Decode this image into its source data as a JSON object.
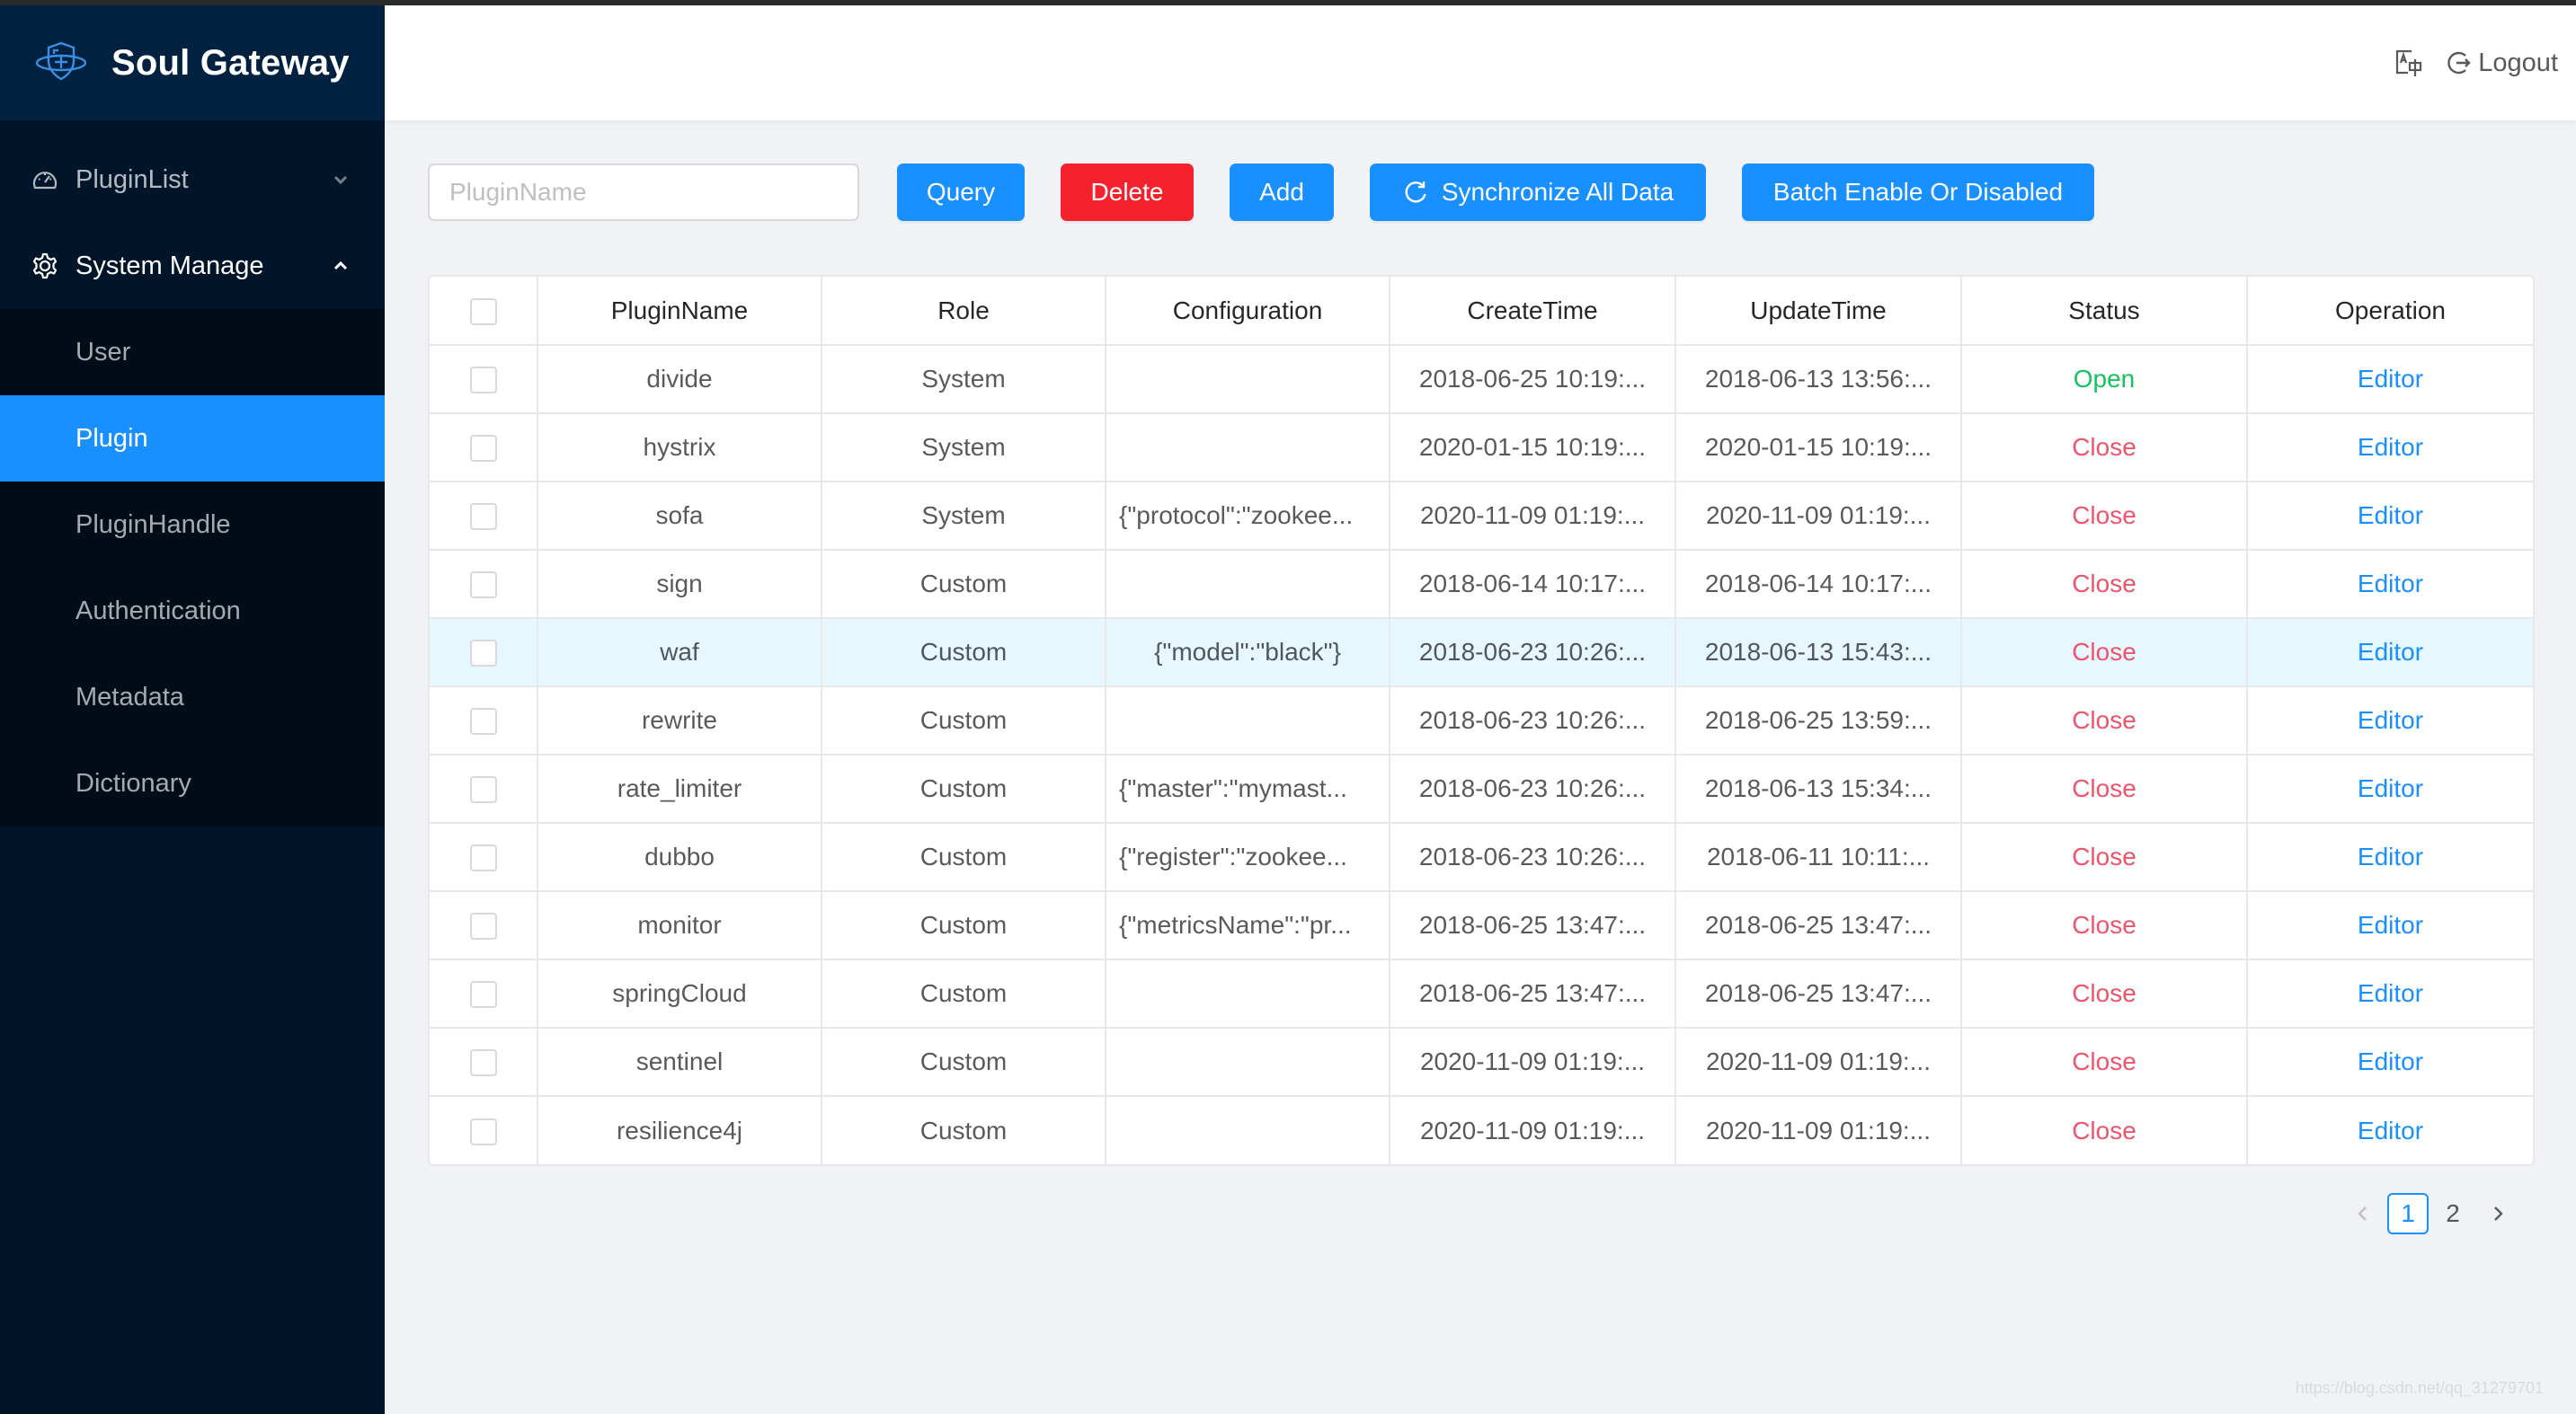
{
  "app": {
    "title": "Soul Gateway",
    "logo_icon": "shield-plus-icon"
  },
  "sidebar": {
    "menus": [
      {
        "label": "PluginList",
        "icon": "dashboard-icon",
        "expanded": false
      },
      {
        "label": "System Manage",
        "icon": "gear-icon",
        "expanded": true
      }
    ],
    "submenu": [
      {
        "label": "User",
        "active": false
      },
      {
        "label": "Plugin",
        "active": true
      },
      {
        "label": "PluginHandle",
        "active": false
      },
      {
        "label": "Authentication",
        "active": false
      },
      {
        "label": "Metadata",
        "active": false
      },
      {
        "label": "Dictionary",
        "active": false
      }
    ]
  },
  "header": {
    "language_icon": "translate-icon",
    "logout_label": "Logout"
  },
  "toolbar": {
    "search_placeholder": "PluginName",
    "search_value": "",
    "query_label": "Query",
    "delete_label": "Delete",
    "add_label": "Add",
    "sync_label": "Synchronize All Data",
    "batch_label": "Batch Enable Or Disabled"
  },
  "table": {
    "columns": [
      "PluginName",
      "Role",
      "Configuration",
      "CreateTime",
      "UpdateTime",
      "Status",
      "Operation"
    ],
    "rows": [
      {
        "name": "divide",
        "role": "System",
        "config": "",
        "create": "2018-06-25 10:19:...",
        "update": "2018-06-13 13:56:...",
        "status": "Open",
        "op": "Editor"
      },
      {
        "name": "hystrix",
        "role": "System",
        "config": "",
        "create": "2020-01-15 10:19:...",
        "update": "2020-01-15 10:19:...",
        "status": "Close",
        "op": "Editor"
      },
      {
        "name": "sofa",
        "role": "System",
        "config": "{\"protocol\":\"zookee...",
        "create": "2020-11-09 01:19:...",
        "update": "2020-11-09 01:19:...",
        "status": "Close",
        "op": "Editor"
      },
      {
        "name": "sign",
        "role": "Custom",
        "config": "",
        "create": "2018-06-14 10:17:...",
        "update": "2018-06-14 10:17:...",
        "status": "Close",
        "op": "Editor"
      },
      {
        "name": "waf",
        "role": "Custom",
        "config": "{\"model\":\"black\"}",
        "create": "2018-06-23 10:26:...",
        "update": "2018-06-13 15:43:...",
        "status": "Close",
        "op": "Editor",
        "highlight": true
      },
      {
        "name": "rewrite",
        "role": "Custom",
        "config": "",
        "create": "2018-06-23 10:26:...",
        "update": "2018-06-25 13:59:...",
        "status": "Close",
        "op": "Editor"
      },
      {
        "name": "rate_limiter",
        "role": "Custom",
        "config": "{\"master\":\"mymast...",
        "create": "2018-06-23 10:26:...",
        "update": "2018-06-13 15:34:...",
        "status": "Close",
        "op": "Editor"
      },
      {
        "name": "dubbo",
        "role": "Custom",
        "config": "{\"register\":\"zookee...",
        "create": "2018-06-23 10:26:...",
        "update": "2018-06-11 10:11:...",
        "status": "Close",
        "op": "Editor"
      },
      {
        "name": "monitor",
        "role": "Custom",
        "config": "{\"metricsName\":\"pr...",
        "create": "2018-06-25 13:47:...",
        "update": "2018-06-25 13:47:...",
        "status": "Close",
        "op": "Editor"
      },
      {
        "name": "springCloud",
        "role": "Custom",
        "config": "",
        "create": "2018-06-25 13:47:...",
        "update": "2018-06-25 13:47:...",
        "status": "Close",
        "op": "Editor"
      },
      {
        "name": "sentinel",
        "role": "Custom",
        "config": "",
        "create": "2020-11-09 01:19:...",
        "update": "2020-11-09 01:19:...",
        "status": "Close",
        "op": "Editor"
      },
      {
        "name": "resilience4j",
        "role": "Custom",
        "config": "",
        "create": "2020-11-09 01:19:...",
        "update": "2020-11-09 01:19:...",
        "status": "Close",
        "op": "Editor"
      }
    ]
  },
  "pagination": {
    "pages": [
      "1",
      "2"
    ],
    "current": "1"
  },
  "colors": {
    "sidebar_bg": "#001529",
    "logo_bg": "#002140",
    "primary": "#1890ff",
    "danger": "#f5222d",
    "status_open": "#14c35e",
    "status_close": "#f0546c"
  },
  "watermark": "https://blog.csdn.net/qq_31279701"
}
